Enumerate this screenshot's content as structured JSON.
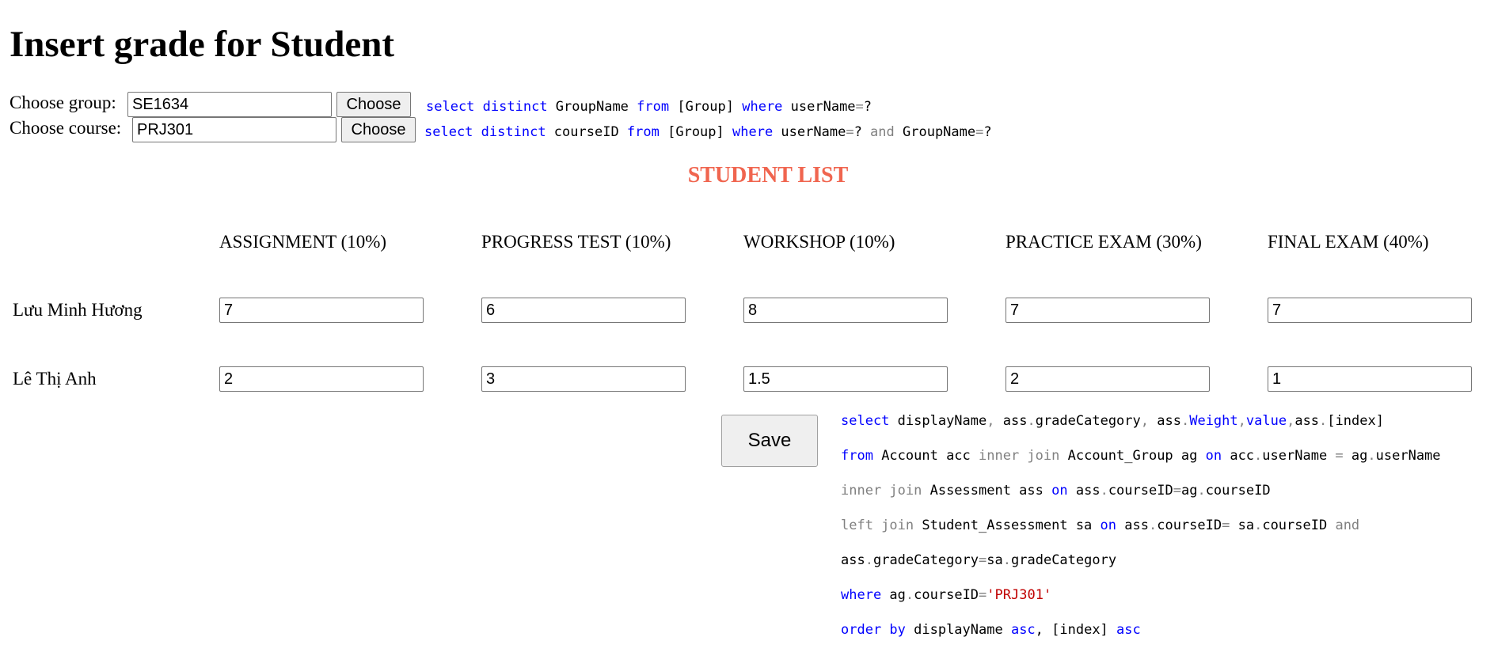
{
  "page_title": "Insert grade for Student",
  "group": {
    "label": "Choose group:",
    "value": "SE1634",
    "button": "Choose"
  },
  "course": {
    "label": "Choose course:",
    "value": "PRJ301",
    "button": "Choose"
  },
  "sql1": {
    "t1": "select",
    "t2": " ",
    "t3": "distinct",
    "t4": " GroupName ",
    "t5": "from",
    "t6": " [Group] ",
    "t7": "where",
    "t8": " userName",
    "t9": "=",
    "t10": "?"
  },
  "sql2": {
    "t1": "select",
    "t2": " ",
    "t3": "distinct",
    "t4": " courseID ",
    "t5": "from",
    "t6": " [Group] ",
    "t7": "where",
    "t8": " userName",
    "t9": "=",
    "t10": "? ",
    "t11": "and",
    "t12": " GroupName",
    "t13": "=",
    "t14": "?"
  },
  "list_title": "STUDENT LIST",
  "columns": [
    "ASSIGNMENT (10%)",
    "PROGRESS TEST (10%)",
    "WORKSHOP (10%)",
    "PRACTICE EXAM (30%)",
    "FINAL EXAM (40%)"
  ],
  "students": [
    {
      "name": "Lưu Minh Hương",
      "grades": [
        "7",
        "6",
        "8",
        "7",
        "7"
      ]
    },
    {
      "name": "Lê Thị Anh",
      "grades": [
        "2",
        "3",
        "1.5",
        "2",
        "1"
      ]
    }
  ],
  "save_label": "Save",
  "sql3": {
    "l1": {
      "a": "select",
      "b": " displayName",
      "c": ",",
      "d": " ass",
      "e": ".",
      "f": "gradeCategory",
      "g": ",",
      "h": " ass",
      "i": ".",
      "j": "Weight",
      "k": ",",
      "l": "value",
      "m": ",",
      "n": "ass",
      "o": ".",
      "p": "[index]"
    },
    "l2": {
      "a": "from",
      "b": " Account acc ",
      "c": "inner join",
      "d": " Account_Group ag ",
      "e": "on",
      "f": " acc",
      "g": ".",
      "h": "userName ",
      "i": "=",
      "j": " ag",
      "k": ".",
      "l": "userName"
    },
    "l3": {
      "a": "inner join",
      "b": " Assessment ass ",
      "c": "on",
      "d": " ass",
      "e": ".",
      "f": "courseID",
      "g": "=",
      "h": "ag",
      "i": ".",
      "j": "courseID"
    },
    "l4": {
      "a": "left join",
      "b": " Student_Assessment sa ",
      "c": "on",
      "d": " ass",
      "e": ".",
      "f": "courseID",
      "g": "=",
      "h": " sa",
      "i": ".",
      "j": "courseID ",
      "k": "and"
    },
    "l5": {
      "a": "ass",
      "b": ".",
      "c": "gradeCategory",
      "d": "=",
      "e": "sa",
      "f": ".",
      "g": "gradeCategory"
    },
    "l6": {
      "a": "where",
      "b": " ag",
      "c": ".",
      "d": "courseID",
      "e": "=",
      "f": "'PRJ301'"
    },
    "l7": {
      "a": "order by",
      "b": " displayName ",
      "c": "asc",
      "d": ", [index] ",
      "e": "asc"
    }
  },
  "colors": {
    "list_title": "#f0654f",
    "keyword": "#0000ff",
    "operator": "#808080",
    "string": "#c00000"
  }
}
